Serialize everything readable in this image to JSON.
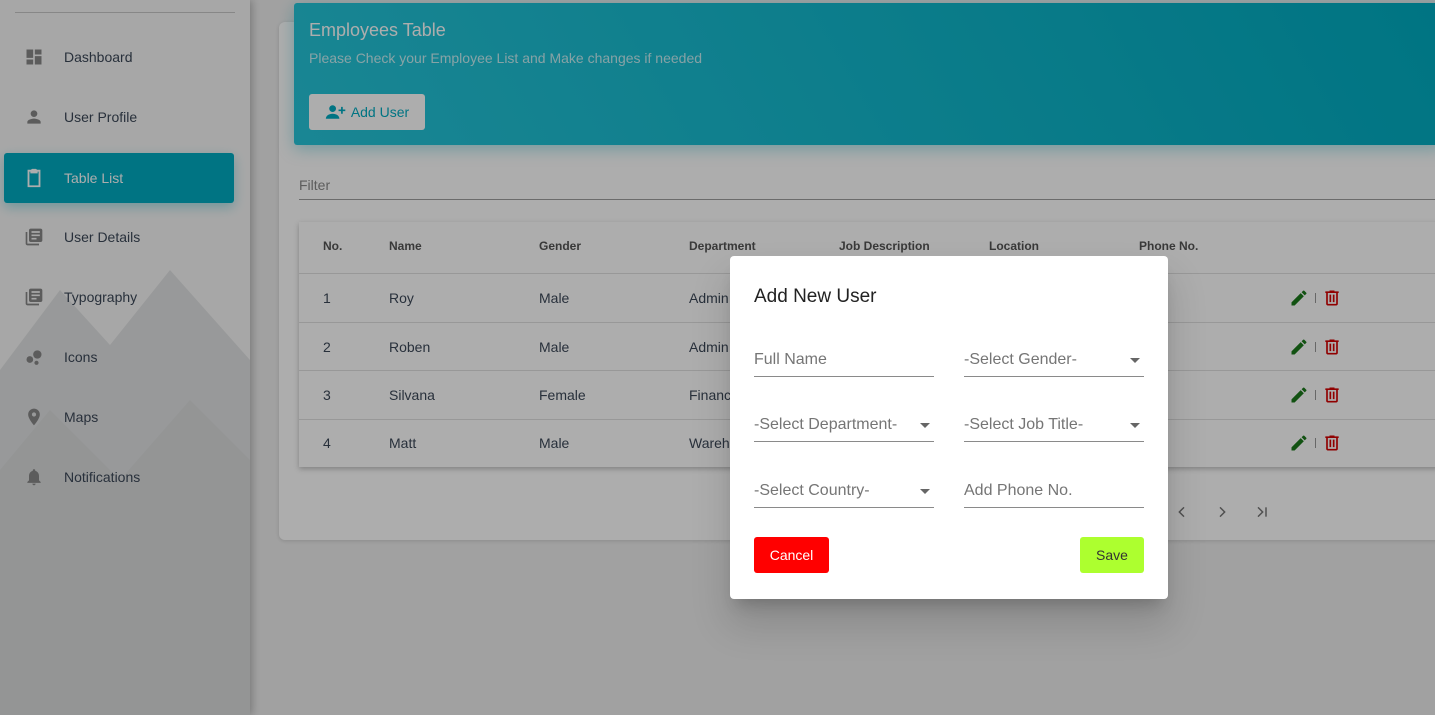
{
  "sidebar": {
    "items": [
      {
        "label": "Dashboard",
        "icon": "dashboard-icon"
      },
      {
        "label": "User Profile",
        "icon": "person-icon"
      },
      {
        "label": "Table List",
        "icon": "clipboard-icon",
        "active": true
      },
      {
        "label": "User Details",
        "icon": "library-books-icon"
      },
      {
        "label": "Typography",
        "icon": "library-books-icon"
      },
      {
        "label": "Icons",
        "icon": "bubble-chart-icon"
      },
      {
        "label": "Maps",
        "icon": "location-pin-icon"
      },
      {
        "label": "Notifications",
        "icon": "bell-icon"
      }
    ]
  },
  "header": {
    "title": "Employees Table",
    "subtitle": "Please Check your Employee List and Make changes if needed",
    "add_user_label": "Add User"
  },
  "filter": {
    "placeholder": "Filter"
  },
  "table": {
    "columns": [
      "No.",
      "Name",
      "Gender",
      "Department",
      "Job Description",
      "Location",
      "Phone No."
    ],
    "rows": [
      {
        "no": "1",
        "name": "Roy",
        "gender": "Male",
        "department": "Admin"
      },
      {
        "no": "2",
        "name": "Roben",
        "gender": "Male",
        "department": "Admin"
      },
      {
        "no": "3",
        "name": "Silvana",
        "gender": "Female",
        "department": "Financ"
      },
      {
        "no": "4",
        "name": "Matt",
        "gender": "Male",
        "department": "Wareh"
      }
    ]
  },
  "modal": {
    "title": "Add New User",
    "fields": {
      "full_name": "Full Name",
      "gender": "-Select Gender-",
      "department": "-Select Department-",
      "job_title": "-Select Job Title-",
      "country": "-Select Country-",
      "phone": "Add Phone No."
    },
    "cancel_label": "Cancel",
    "save_label": "Save"
  },
  "colors": {
    "accent": "#00acc1",
    "edit": "#1b7a1b",
    "delete": "#d50000",
    "cancel": "#ff0000",
    "save": "#adff2f"
  }
}
